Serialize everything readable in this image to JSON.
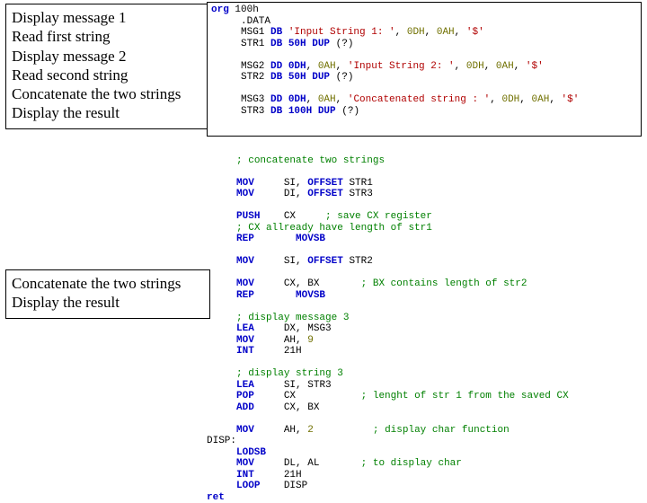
{
  "box1": {
    "l1": "Display message 1",
    "l2": "Read first string",
    "l3": "Display message 2",
    "l4": "Read second string",
    "l5": "Concatenate the two strings",
    "l6": "Display the result"
  },
  "box2": {
    "l1": "Concatenate the two strings",
    "l2": "Display the result"
  },
  "code_top": {
    "l0a": "org",
    "l0b": " 100h",
    "l1a": "     .DATA",
    "l2a": "     MSG1 ",
    "l2b": "DB",
    "l2c": " 'Input String 1: '",
    "l2d": ", ",
    "l2e": "0DH",
    "l2f": ", ",
    "l2g": "0AH",
    "l2h": ", ",
    "l2i": "'$'",
    "l3a": "     STR1 ",
    "l3b": "DB 50H DUP",
    "l3c": " (?)",
    "l4": "",
    "l5a": "     MSG2 ",
    "l5b": "DD 0DH",
    "l5c": ", ",
    "l5d": "0AH",
    "l5e": ", ",
    "l5f": "'Input String 2: '",
    "l5g": ", ",
    "l5h": "0DH",
    "l5i": ", ",
    "l5j": "0AH",
    "l5k": ", ",
    "l5l": "'$'",
    "l6a": "     STR2 ",
    "l6b": "DB 50H DUP",
    "l6c": " (?)",
    "l7": "",
    "l8a": "     MSG3 ",
    "l8b": "DD 0DH",
    "l8c": ", ",
    "l8d": "0AH",
    "l8e": ", ",
    "l8f": "'Concatenated string : '",
    "l8g": ", ",
    "l8h": "0DH",
    "l8i": ", ",
    "l8j": "0AH",
    "l8k": ", ",
    "l8l": "'$'",
    "l9a": "     STR3 ",
    "l9b": "DB 100H DUP",
    "l9c": " (?)"
  },
  "code_rest": {
    "c1": "; concatenate two strings",
    "m1a": "MOV",
    "m1b": "     SI, ",
    "m1c": "OFFSET",
    "m1d": " STR1",
    "m2a": "MOV",
    "m2b": "     DI, ",
    "m2c": "OFFSET",
    "m2d": " STR3",
    "p1a": "PUSH",
    "p1b": "    CX     ",
    "p1c": "; save CX register",
    "c2": "; CX allready have length of str1",
    "r1a": "REP       MOVSB",
    "m3a": "MOV",
    "m3b": "     SI, ",
    "m3c": "OFFSET",
    "m3d": " STR2",
    "m4a": "MOV",
    "m4b": "     CX, BX       ",
    "m4c": "; BX contains length of str2",
    "r2a": "REP       MOVSB",
    "c3": "; display message 3",
    "l1a": "LEA",
    "l1b": "     DX, MSG3",
    "m5a": "MOV",
    "m5b": "     AH, ",
    "m5c": "9",
    "i1a": "INT",
    "i1b": "     21H",
    "c4": "; display string 3",
    "l2a": "LEA",
    "l2b": "     SI, STR3",
    "p2a": "POP",
    "p2b": "     CX           ",
    "p2c": "; lenght of str 1 from the saved CX",
    "a1a": "ADD",
    "a1b": "     CX, BX",
    "m6a": "MOV",
    "m6b": "     AH, ",
    "m6c": "2",
    "m6d": "          ",
    "m6e": "; display char function",
    "d1a": "DISP:",
    "lo1": "     LODSB",
    "m7a": "MOV",
    "m7b": "     DL, AL       ",
    "m7c": "; to display char",
    "i2a": "INT",
    "i2b": "     21H",
    "lp1a": "LOOP",
    "lp1b": "    DISP",
    "ret": "ret"
  }
}
